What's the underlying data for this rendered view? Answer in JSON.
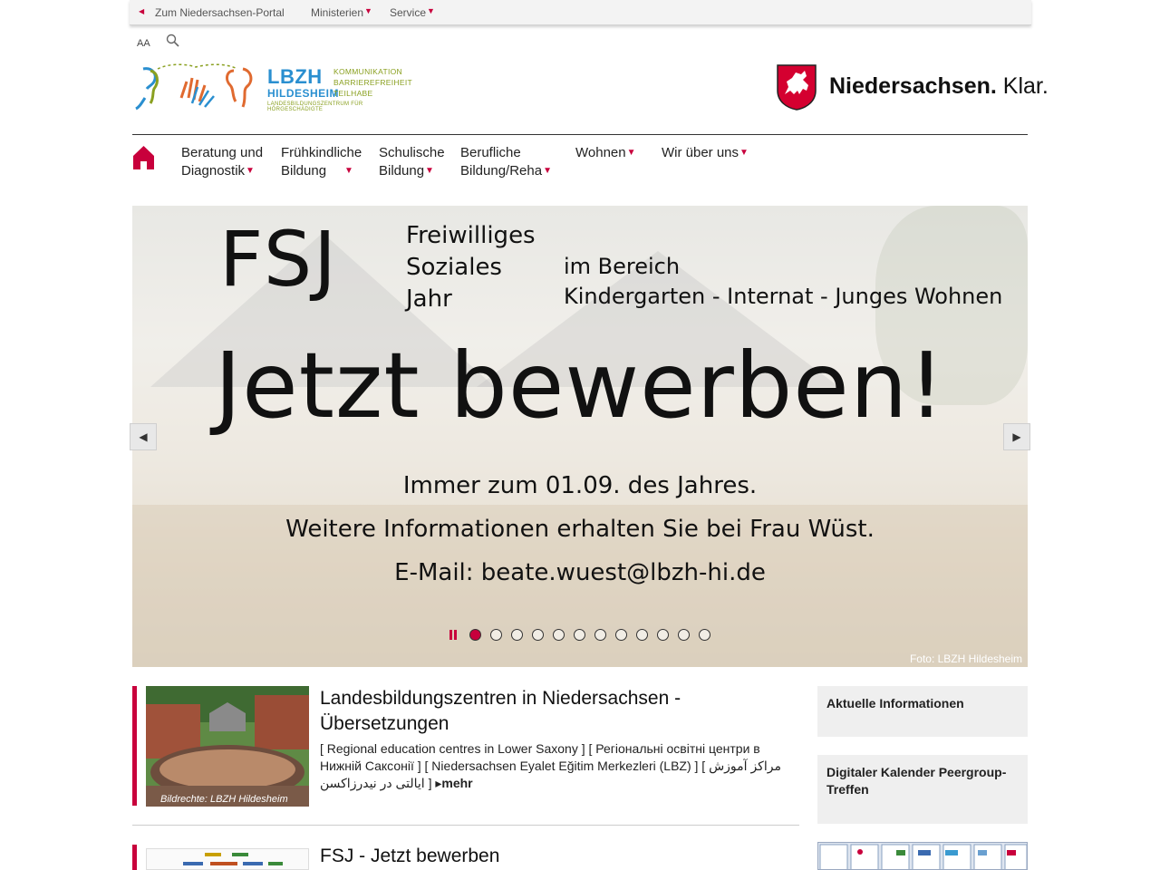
{
  "utility_nav": {
    "portal_link": "Zum Niedersachsen-Portal",
    "ministerien": "Ministerien",
    "service": "Service"
  },
  "tools": {
    "font_size_toggle": "AA"
  },
  "logo": {
    "name": "LBZH",
    "city": "HILDESHEIM",
    "tag1": "KOMMUNIKATION",
    "tag2": "BARRIEREFREIHEIT",
    "tag3": "TEILHABE",
    "subtitle": "LANDESBILDUNGSZENTRUM FÜR HÖRGESCHÄDIGTE"
  },
  "state_logo": {
    "brand": "Niedersachsen.",
    "claim": "Klar."
  },
  "main_nav": [
    {
      "line1": "Beratung und",
      "line2": "Diagnostik"
    },
    {
      "line1": "Frühkindliche",
      "line2": "Bildung"
    },
    {
      "line1": "Schulische",
      "line2": "Bildung"
    },
    {
      "line1": "Berufliche",
      "line2": "Bildung/Reha"
    },
    {
      "line1": "Wohnen",
      "line2": ""
    },
    {
      "line1": "Wir über uns",
      "line2": ""
    }
  ],
  "slider": {
    "fsj": "FSJ",
    "fsj_line1": "Freiwilliges",
    "fsj_line2": "Soziales",
    "fsj_line3": "Jahr",
    "area_line1": "im Bereich",
    "area_line2": "Kindergarten - Internat - Junges Wohnen",
    "headline": "Jetzt bewerben!",
    "line1": "Immer zum 01.09. des Jahres.",
    "line2": "Weitere Informationen erhalten Sie bei Frau Wüst.",
    "line3": "E-Mail: beate.wuest@lbzh-hi.de",
    "photo_credit": "Foto: LBZH Hildesheim",
    "slide_count": 12,
    "active_slide": 1,
    "accent_color": "#c8003c"
  },
  "teasers": [
    {
      "title": "Landesbildungszentren in Niedersachsen - Übersetzungen",
      "text": "[ Regional education centres in Lower Saxony ] [ Регіональні освітні центри в Нижній Саксонії ] [ Niedersachsen Eyalet Eğitim Merkezleri (LBZ) ] [ مراکز آموزش ایالتی در نیدرزاکسن ]",
      "more": "mehr",
      "image_credit": "Bildrechte: LBZH Hildesheim"
    },
    {
      "title": "FSJ - Jetzt bewerben"
    }
  ],
  "sidebar": {
    "box1": "Aktuelle Informationen",
    "box2": "Digitaler Kalender Peergroup-Treffen"
  }
}
